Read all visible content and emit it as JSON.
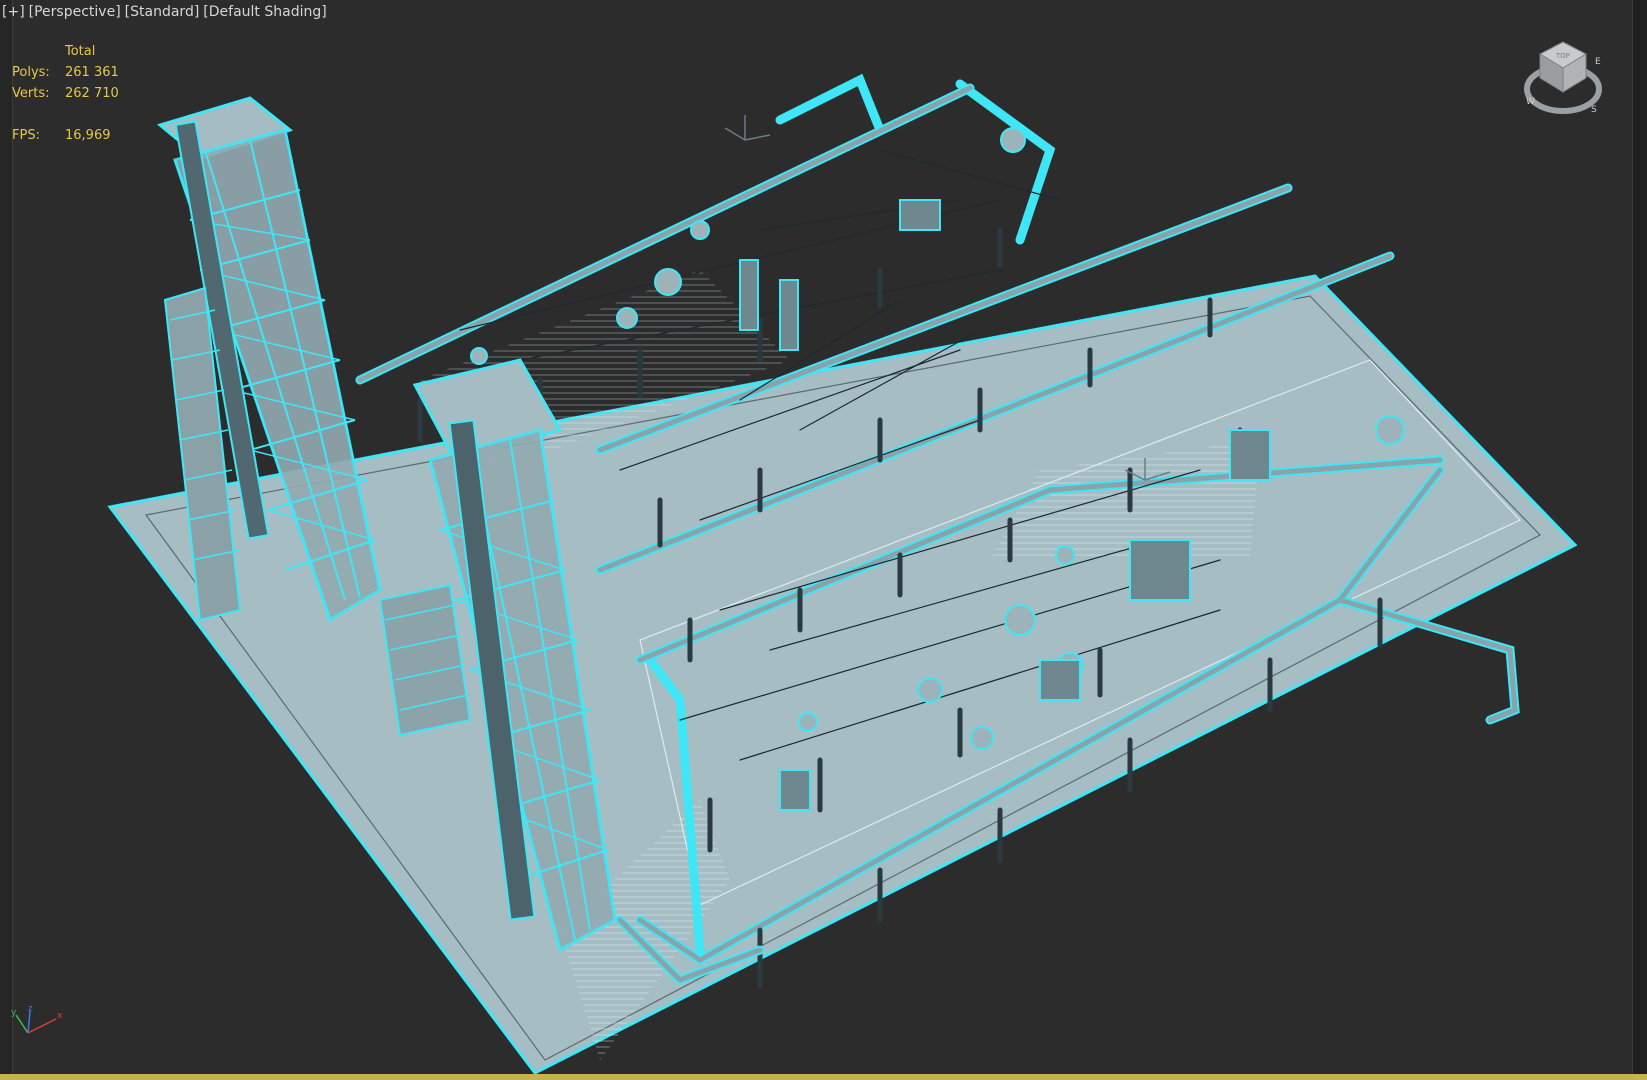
{
  "viewport": {
    "labels": [
      "[+]",
      "[Perspective]",
      "[Standard]",
      "[Default Shading]"
    ],
    "stats": {
      "header": "Total",
      "polys_label": "Polys:",
      "polys_value": "261 361",
      "verts_label": "Verts:",
      "verts_value": "262 710",
      "fps_label": "FPS:",
      "fps_value": "16,969"
    },
    "viewcube": {
      "face": "TOP",
      "compass": [
        "W",
        "S",
        "E"
      ]
    },
    "axis_labels": [
      "y",
      "z",
      "x"
    ],
    "colors": {
      "background": "#2c2c2c",
      "selection": "#39e0f2",
      "ground": "#a6bcc3",
      "stats_text": "#e6c84a"
    }
  }
}
